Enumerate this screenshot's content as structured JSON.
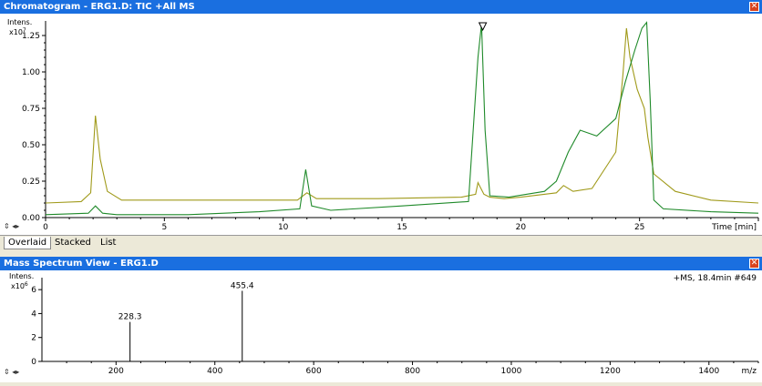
{
  "chromatogram_window": {
    "title": "Chromatogram - ERG1.D: TIC +All MS",
    "close_glyph": "✕",
    "spin_glyph": "⇕ ◂▸"
  },
  "tabs": [
    {
      "label": "Overlaid"
    },
    {
      "label": "Stacked"
    },
    {
      "label": "List"
    }
  ],
  "spectrum_window": {
    "title": "Mass Spectrum View - ERG1.D",
    "close_glyph": "✕",
    "spin_glyph": "⇕ ◂▸"
  },
  "chart_data": [
    {
      "type": "line",
      "title": "",
      "xlabel": "Time [min]",
      "ylabel": "Intens.",
      "y_exponent": "x10",
      "y_exponent_power": "7",
      "xlim": [
        0,
        30
      ],
      "ylim": [
        0,
        1.35
      ],
      "xticks": [
        0,
        5,
        10,
        15,
        20,
        25
      ],
      "yticks": [
        "0.00",
        "0.25",
        "0.50",
        "0.75",
        "1.00",
        "1.25"
      ],
      "marker_time": 18.4,
      "series": [
        {
          "color": "#a09a1a",
          "x": [
            0,
            1.5,
            1.9,
            2.1,
            2.3,
            2.6,
            3.2,
            5,
            8,
            10.6,
            11.0,
            11.4,
            14,
            17.5,
            18.1,
            18.2,
            18.45,
            18.7,
            19.3,
            20,
            21.5,
            21.8,
            22.2,
            23,
            24.0,
            24.3,
            24.45,
            24.6,
            24.9,
            25.2,
            25.35,
            25.6,
            26.5,
            28,
            30
          ],
          "values": [
            0.1,
            0.11,
            0.17,
            0.7,
            0.4,
            0.18,
            0.12,
            0.12,
            0.12,
            0.12,
            0.17,
            0.13,
            0.13,
            0.14,
            0.16,
            0.24,
            0.16,
            0.14,
            0.13,
            0.14,
            0.17,
            0.22,
            0.18,
            0.2,
            0.45,
            0.98,
            1.3,
            1.1,
            0.88,
            0.75,
            0.55,
            0.3,
            0.18,
            0.12,
            0.1
          ]
        },
        {
          "color": "#1f8a2a",
          "x": [
            0,
            1.8,
            2.1,
            2.4,
            3,
            6,
            9,
            10.7,
            10.95,
            11.2,
            12,
            15,
            17.8,
            18.2,
            18.35,
            18.5,
            18.7,
            19.5,
            21,
            21.5,
            22.0,
            22.5,
            23.2,
            24.0,
            24.4,
            24.8,
            25.1,
            25.3,
            25.45,
            25.6,
            26,
            28,
            30
          ],
          "values": [
            0.02,
            0.03,
            0.08,
            0.03,
            0.02,
            0.02,
            0.04,
            0.06,
            0.33,
            0.08,
            0.05,
            0.08,
            0.11,
            1.1,
            1.33,
            0.6,
            0.15,
            0.14,
            0.18,
            0.25,
            0.45,
            0.6,
            0.56,
            0.68,
            0.93,
            1.15,
            1.3,
            1.34,
            0.8,
            0.12,
            0.06,
            0.04,
            0.03
          ]
        }
      ]
    },
    {
      "type": "bar",
      "title": "",
      "annotation": "+MS, 18.4min #649",
      "xlabel": "m/z",
      "ylabel": "Intens.",
      "y_exponent": "x10",
      "y_exponent_power": "6",
      "xlim": [
        50,
        1500
      ],
      "ylim": [
        0,
        7
      ],
      "xticks": [
        200,
        400,
        600,
        800,
        1000,
        1200,
        1400
      ],
      "yticks": [
        "0",
        "2",
        "4",
        "6"
      ],
      "peaks": [
        {
          "mz": 228.3,
          "intensity": 3.3,
          "label": "228.3"
        },
        {
          "mz": 455.4,
          "intensity": 5.9,
          "label": "455.4"
        }
      ]
    }
  ]
}
